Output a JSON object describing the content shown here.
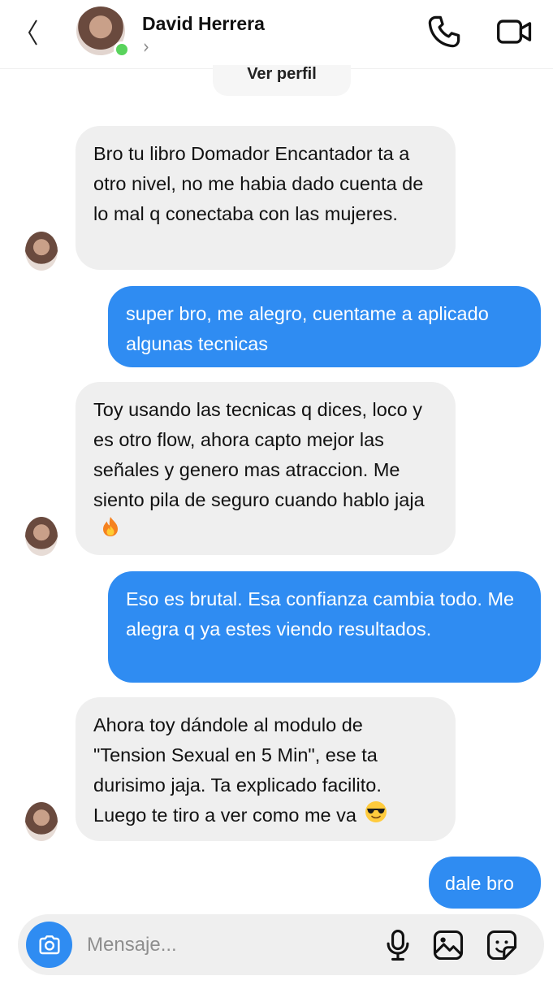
{
  "header": {
    "contact_name": "David Herrera",
    "chevron": "›",
    "view_profile": "Ver perfil",
    "online_color": "#59d35c"
  },
  "messages": [
    {
      "from": "them",
      "text": "Bro tu libro Domador Encantador ta a otro nivel, no me habia dado cuenta de lo mal q conectaba con las mujeres."
    },
    {
      "from": "me",
      "text": "super bro, me alegro, cuentame a aplicado algunas tecnicas"
    },
    {
      "from": "them",
      "text": "Toy usando las tecnicas q dices, loco y es otro flow, ahora capto mejor las señales y genero mas atraccion. Me siento pila de seguro cuando hablo jaja",
      "emoji": "fire-emoji"
    },
    {
      "from": "me",
      "text": "Eso es brutal. Esa confianza cambia todo. Me alegra q ya estes viendo resultados."
    },
    {
      "from": "them",
      "text": "Ahora toy dándole al modulo de \"Tension Sexual en 5 Min\", ese ta durisimo jaja. Ta explicado facilito. Luego te tiro a ver como me va",
      "emoji": "sunglasses-emoji"
    },
    {
      "from": "me",
      "text": "dale bro"
    }
  ],
  "composer": {
    "placeholder": "Mensaje...",
    "icons": [
      "camera-icon",
      "microphone-icon",
      "image-icon",
      "sticker-icon"
    ]
  },
  "colors": {
    "outgoing_bubble": "#2f8cf2",
    "incoming_bubble": "#efefef",
    "accent": "#2f8cf2"
  }
}
